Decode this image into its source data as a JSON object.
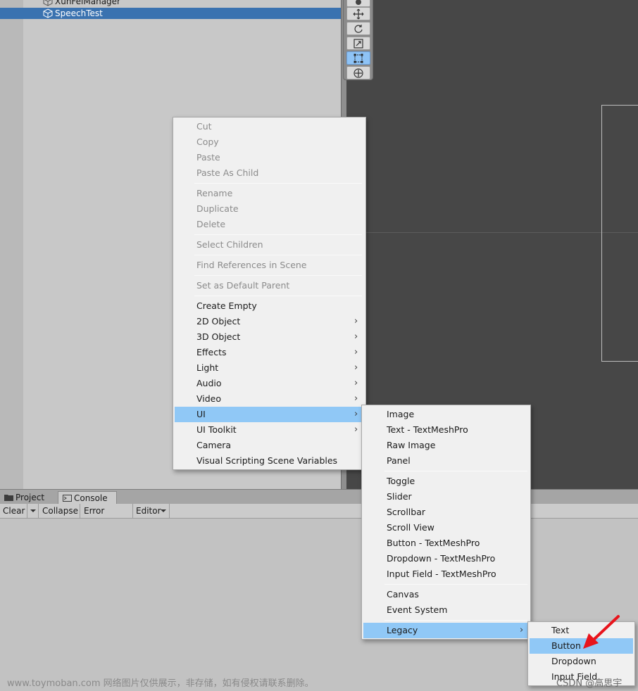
{
  "hierarchy": {
    "items": [
      {
        "label": "XunFeiManager",
        "selected": false
      },
      {
        "label": "SpeechTest",
        "selected": true
      }
    ]
  },
  "scene": {
    "tools": [
      "hand-icon",
      "move-icon",
      "rotate-icon",
      "scale-icon",
      "rect-icon",
      "transform-icon"
    ],
    "active_tool": "rect-icon"
  },
  "bottom_panel": {
    "tabs": [
      {
        "label": "Project",
        "icon": "folder-icon",
        "active": false
      },
      {
        "label": "Console",
        "icon": "console-icon",
        "active": true
      }
    ],
    "toolbar": {
      "clear": "Clear",
      "collapse": "Collapse",
      "error_pause": "Error Pause",
      "editor": "Editor"
    }
  },
  "context_menu": {
    "items": [
      {
        "label": "Cut",
        "disabled": true
      },
      {
        "label": "Copy",
        "disabled": true
      },
      {
        "label": "Paste",
        "disabled": true
      },
      {
        "label": "Paste As Child",
        "disabled": true
      },
      {
        "label": "Rename",
        "disabled": true
      },
      {
        "label": "Duplicate",
        "disabled": true
      },
      {
        "label": "Delete",
        "disabled": true
      },
      {
        "label": "Select Children",
        "disabled": true
      },
      {
        "label": "Find References in Scene",
        "disabled": true
      },
      {
        "label": "Set as Default Parent",
        "disabled": true
      },
      {
        "label": "Create Empty"
      },
      {
        "label": "2D Object",
        "submenu": true
      },
      {
        "label": "3D Object",
        "submenu": true
      },
      {
        "label": "Effects",
        "submenu": true
      },
      {
        "label": "Light",
        "submenu": true
      },
      {
        "label": "Audio",
        "submenu": true
      },
      {
        "label": "Video",
        "submenu": true
      },
      {
        "label": "UI",
        "submenu": true,
        "highlighted": true
      },
      {
        "label": "UI Toolkit",
        "submenu": true
      },
      {
        "label": "Camera"
      },
      {
        "label": "Visual Scripting Scene Variables"
      }
    ]
  },
  "ui_submenu": {
    "items": [
      {
        "label": "Image"
      },
      {
        "label": "Text - TextMeshPro"
      },
      {
        "label": "Raw Image"
      },
      {
        "label": "Panel"
      },
      {
        "label": "Toggle"
      },
      {
        "label": "Slider"
      },
      {
        "label": "Scrollbar"
      },
      {
        "label": "Scroll View"
      },
      {
        "label": "Button - TextMeshPro"
      },
      {
        "label": "Dropdown - TextMeshPro"
      },
      {
        "label": "Input Field - TextMeshPro"
      },
      {
        "label": "Canvas"
      },
      {
        "label": "Event System"
      },
      {
        "label": "Legacy",
        "submenu": true,
        "highlighted": true
      }
    ]
  },
  "legacy_submenu": {
    "items": [
      {
        "label": "Text"
      },
      {
        "label": "Button",
        "highlighted": true
      },
      {
        "label": "Dropdown"
      },
      {
        "label": "Input Field"
      }
    ]
  },
  "watermarks": {
    "left": "www.toymoban.com 网络图片仅供展示，非存储，如有侵权请联系删除。",
    "right": "CSDN @高思宇"
  },
  "colors": {
    "selection": "#3a72b0",
    "menu_highlight": "#90c8f6",
    "annotation_arrow": "#e8141c",
    "scene_background": "#474747"
  }
}
